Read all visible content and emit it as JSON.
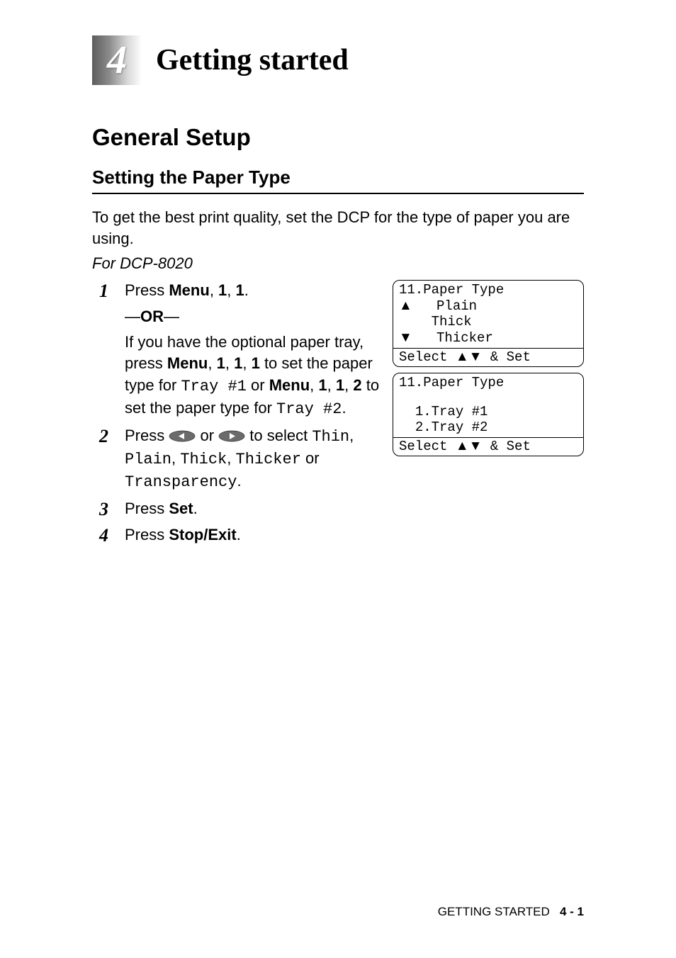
{
  "chapter": {
    "number": "4",
    "title": "Getting started"
  },
  "section": {
    "heading": "General Setup",
    "subheading": "Setting the Paper Type"
  },
  "intro": "To get the best print quality, set the DCP for the type of paper you are using.",
  "model_label": "For DCP-8020",
  "steps": [
    {
      "num": "1",
      "press_label": "Press ",
      "menu_bold": "Menu",
      "comma1": ", ",
      "key1": "1",
      "comma2": ", ",
      "key2": "1",
      "period": ".",
      "or_label": "OR",
      "or_dash": "—",
      "followup_a": "If you have the optional paper tray, press ",
      "menu_bold_b": "Menu",
      "comma_b1": ", ",
      "key_b1": "1",
      "comma_b2": ", ",
      "key_b2": "1",
      "comma_b3": ", ",
      "key_b3": "1",
      "followup_b": " to set the paper type for ",
      "tray1": "Tray #1",
      "followup_c": " or ",
      "menu_bold_c": "Menu",
      "comma_c1": ", ",
      "key_c1": "1",
      "comma_c2": ", ",
      "key_c2": "1",
      "comma_c3": ", ",
      "key_c3": "2",
      "followup_d": " to set the paper type for ",
      "tray2": "Tray #2",
      "period_end": "."
    },
    {
      "num": "2",
      "press_label": "Press ",
      "or_label": " or ",
      "to_select": " to select ",
      "opt_thin": "Thin",
      "comma1": ", ",
      "opt_plain": "Plain",
      "comma2": ", ",
      "opt_thick": "Thick",
      "comma3": ", ",
      "opt_thicker": "Thicker",
      "or_word": " or ",
      "opt_transparency": "Transparency",
      "period": "."
    },
    {
      "num": "3",
      "press_label": "Press ",
      "set_bold": "Set",
      "period": "."
    },
    {
      "num": "4",
      "press_label": "Press ",
      "stopexit_bold": "Stop/Exit",
      "period": "."
    }
  ],
  "display1": {
    "title": "11.Paper Type",
    "line1": "Plain",
    "line2": "Thick",
    "line3": "Thicker",
    "select_prefix": "Select ",
    "select_suffix": " & Set"
  },
  "display2": {
    "title": "11.Paper Type",
    "line1": "1.Tray #1",
    "line2": "2.Tray #2",
    "select_prefix": "Select ",
    "select_suffix": " & Set"
  },
  "footer": {
    "text": "GETTING STARTED",
    "page": "4 - 1"
  }
}
